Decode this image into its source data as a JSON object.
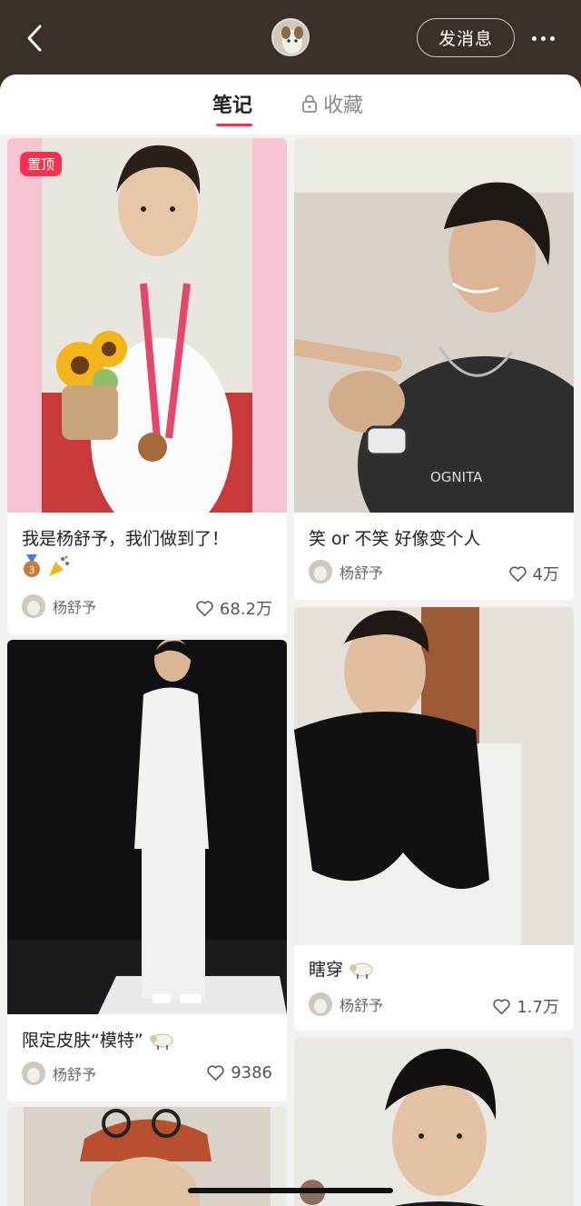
{
  "header": {
    "message_label": "发消息",
    "back_icon": "chevron-left-icon",
    "more_icon": "more-dots-icon"
  },
  "tabs": [
    {
      "label": "笔记",
      "active": true
    },
    {
      "label": "收藏",
      "active": false,
      "icon": "lock-icon"
    }
  ],
  "colors": {
    "accent": "#e8364f",
    "pin": "#ff2e4d",
    "header_bg": "#3b3029"
  },
  "notes": [
    {
      "title": "我是杨舒予，我们做到了！",
      "emoji": [
        "bronze-medal",
        "party-popper"
      ],
      "author": "杨舒予",
      "likes": "68.2万",
      "pinned": true,
      "pin_label": "置顶"
    },
    {
      "title": "笑 or 不笑 好像变个人",
      "author": "杨舒予",
      "likes": "4万"
    },
    {
      "title": "限定皮肤“模特”",
      "emoji": [
        "sheep"
      ],
      "author": "杨舒予",
      "likes": "9386"
    },
    {
      "title": "瞎穿",
      "emoji": [
        "sheep"
      ],
      "author": "杨舒予",
      "likes": "1.7万"
    }
  ]
}
